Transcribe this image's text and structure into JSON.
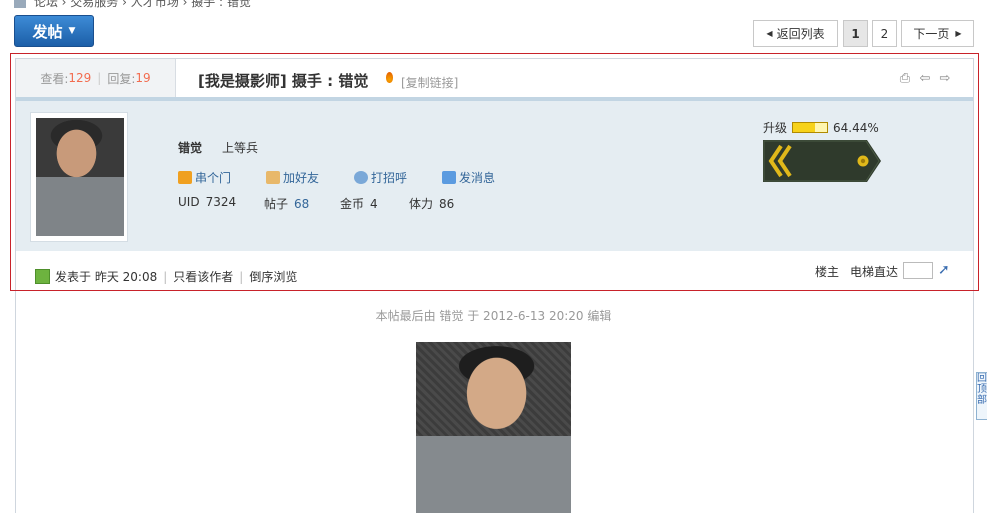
{
  "breadcrumb": [
    "论坛",
    "交易服务",
    "人才市场",
    "摄手 : 错觉"
  ],
  "toolbar": {
    "post_label": "发帖"
  },
  "pager": {
    "back": "返回列表",
    "pages": [
      "1",
      "2"
    ],
    "next": "下一页"
  },
  "thread": {
    "views_label": "查看:",
    "views": "129",
    "replies_label": "回复:",
    "replies": "19",
    "title": "[我是摄影师] 摄手 : 错觉",
    "copy_link": "[复制链接]"
  },
  "author": {
    "name": "错觉",
    "rank": "上等兵",
    "actions": [
      "串个门",
      "加好友",
      "打招呼",
      "发消息"
    ],
    "uid_label": "UID",
    "uid": "7324",
    "posts_label": "帖子",
    "posts": "68",
    "coins_label": "金币",
    "coins": "4",
    "stamina_label": "体力",
    "stamina": "86",
    "upgrade_label": "升级",
    "upgrade_pct": "64.44%",
    "upgrade_fraction": 0.6444
  },
  "post": {
    "time": "发表于 昨天 20:08",
    "only_author": "只看该作者",
    "reverse": "倒序浏览",
    "floor": "楼主",
    "elevator": "电梯直达",
    "edit_note": "本帖最后由 错觉 于 2012-6-13 20:20 编辑"
  },
  "side": {
    "back_top": "回顶部"
  },
  "colors": {
    "accent": "#1c5fa8",
    "highlight": "#f26c4f",
    "panel": "#e5edf2",
    "frame": "#c8222a"
  }
}
